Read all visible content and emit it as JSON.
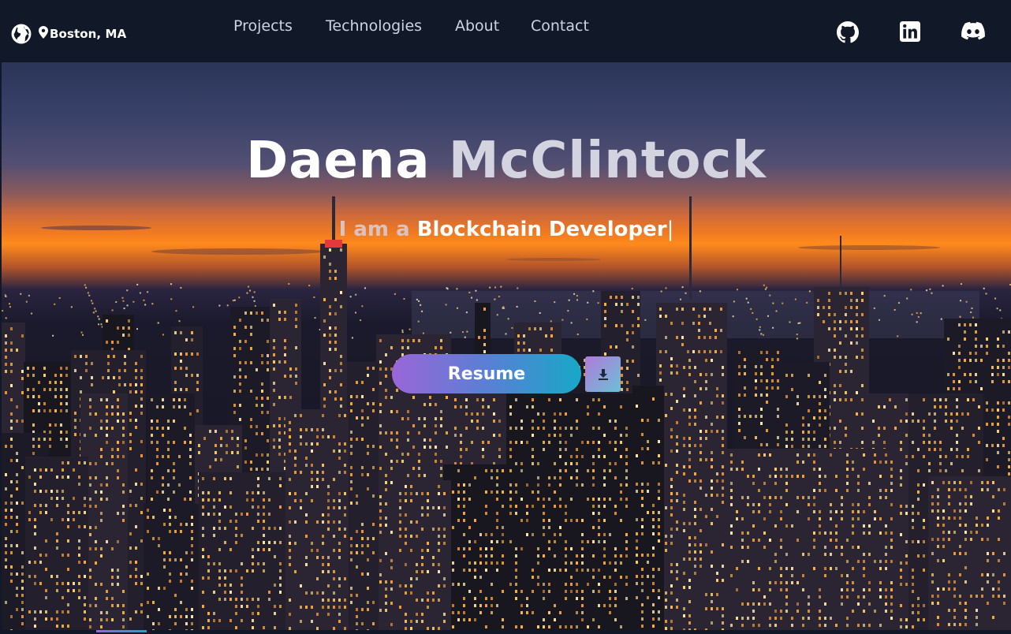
{
  "nav": {
    "location": "Boston, MA",
    "links": [
      "Projects",
      "Technologies",
      "About",
      "Contact"
    ],
    "social_icons": [
      "github-icon",
      "linkedin-icon",
      "discord-icon"
    ],
    "location_icons": [
      "globe-icon",
      "map-pin-icon"
    ]
  },
  "hero": {
    "first_name": "Daena",
    "last_name": "McClintock",
    "subtitle_prefix": "I am a",
    "role": "Blockchain Developer",
    "cursor": "|",
    "resume_label": "Resume",
    "download_icon": "download-icon"
  },
  "colors": {
    "nav_bg": "#111827",
    "nav_link": "#cbd5e1",
    "accent_start": "#9a66d8",
    "accent_end": "#17a8c8"
  }
}
